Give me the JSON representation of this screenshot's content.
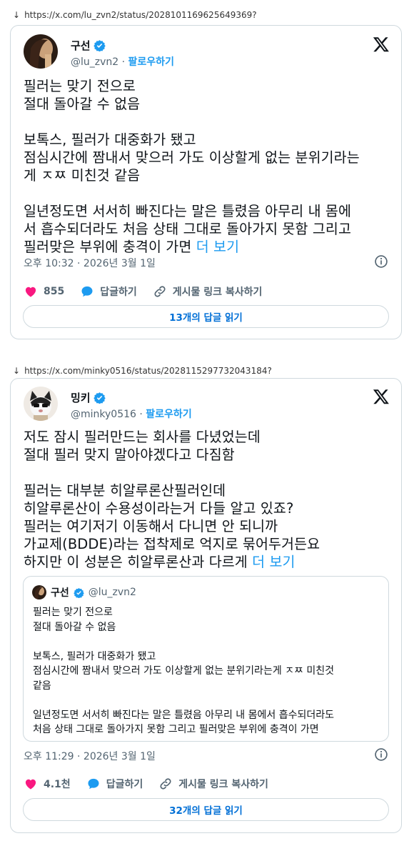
{
  "tweets": [
    {
      "url_arrow": "↓",
      "url": "https://x.com/lu_zvn2/status/2028101169625649369?",
      "author": {
        "name": "구선",
        "handle": "@lu_zvn2",
        "follow": "팔로우하기"
      },
      "text": "필러는 맞기 전으로\n절대 돌아갈 수 없음\n\n보톡스, 필러가 대중화가 됐고\n점심시간에 짬내서 맞으러 가도 이상할게 없는 분위기라는\n게 ㅈㅉ 미친것 같음\n\n일년정도면 서서히 빠진다는 말은 틀렸음 아무리 내 몸에\n서 흡수되더라도 처음 상태 그대로 돌아가지 못함 그리고\n필러맞은 부위에 충격이 가면 ",
      "more": "더 보기",
      "timestamp": "오후 10:32 · 2026년 3월 1일",
      "likes": "855",
      "reply_label": "답글하기",
      "copy_label": "게시물 링크 복사하기",
      "read_replies": "13개의 답글 읽기"
    },
    {
      "url_arrow": "↓",
      "url": "https://x.com/minky0516/status/2028115297732043184?",
      "author": {
        "name": "밍키",
        "handle": "@minky0516",
        "follow": "팔로우하기"
      },
      "text": "저도 잠시 필러만드는 회사를 다녔었는데\n절대 필러 맞지 말아야겠다고 다짐함\n\n필러는 대부분 히알루론산필러인데\n히알루론산이 수용성이라는거 다들 알고 있죠?\n필러는 여기저기 이동해서 다니면 안 되니까\n가교제(BDDE)라는 접착제로 억지로 묶어두거든요\n하지만 이 성분은 히알루론산과 다르게 ",
      "more": "더 보기",
      "quote": {
        "name": "구선",
        "handle": "@lu_zvn2",
        "text": "필러는 맞기 전으로\n절대 돌아갈 수 없음\n\n보톡스, 필러가 대중화가 됐고\n점심시간에 짬내서 맞으러 가도 이상할게 없는 분위기라는게 ㅈㅉ 미친것\n같음\n\n일년정도면 서서히 빠진다는 말은 틀렸음 아무리 내 몸에서 흡수되더라도\n처음 상태 그대로 돌아가지 못함 그리고 필러맞은 부위에 충격이 가면"
      },
      "timestamp": "오후 11:29 · 2026년 3월 1일",
      "likes": "4.1천",
      "reply_label": "답글하기",
      "copy_label": "게시물 링크 복사하기",
      "read_replies": "32개의 답글 읽기"
    }
  ],
  "colors": {
    "accent": "#1d9bf0",
    "like": "#f91880",
    "reply": "#1d9bf0",
    "muted": "#536471",
    "border": "#cfd9de"
  }
}
